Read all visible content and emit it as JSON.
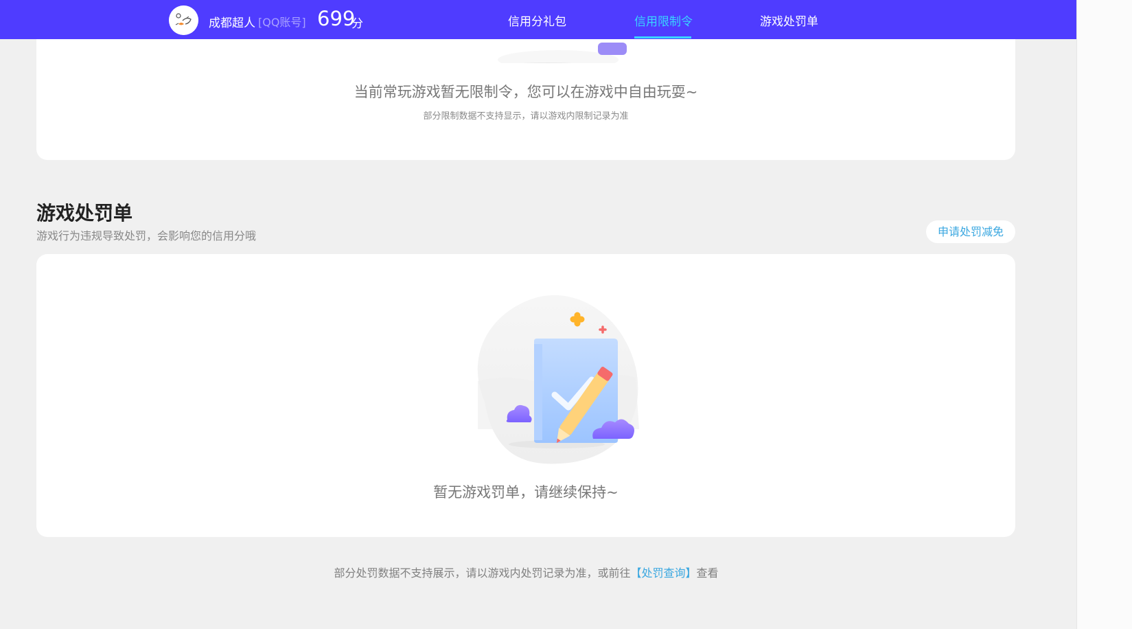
{
  "header": {
    "nickname": "成都超人",
    "account_type": "[QQ账号]",
    "score": "699",
    "score_unit": "分",
    "nav": [
      {
        "label": "信用分礼包"
      },
      {
        "label": "信用限制令",
        "active": true
      },
      {
        "label": "游戏处罚单"
      }
    ]
  },
  "restriction": {
    "empty_message": "当前常玩游戏暂无限制令，您可以在游戏中自由玩耍~",
    "note": "部分限制数据不支持显示，请以游戏内限制记录为准"
  },
  "penalty": {
    "title": "游戏处罚单",
    "subtitle": "游戏行为违规导致处罚，会影响您的信用分哦",
    "appeal_button": "申请处罚减免",
    "empty_message": "暂无游戏罚单，请继续保持~"
  },
  "footer": {
    "note_prefix": "部分处罚数据不支持展示，请以游戏内处罚记录为准，或前往",
    "link": "【处罚查询】",
    "note_suffix": "查看"
  },
  "colors": {
    "header_bg": "#4f3cff",
    "accent": "#39d4ff",
    "link": "#3aa7e0",
    "page_bg": "#f0f0f0"
  },
  "icons": [
    "user-avatar",
    "empty-penalty-illustration",
    "empty-restriction-illustration"
  ]
}
